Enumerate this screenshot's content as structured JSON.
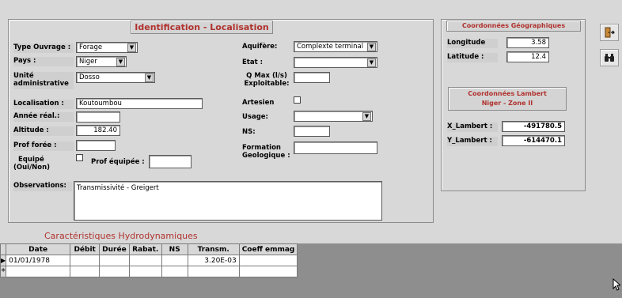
{
  "identification": {
    "title": "Identification - Localisation",
    "type_ouvrage_label": "Type Ouvrage :",
    "type_ouvrage_value": "Forage",
    "pays_label": "Pays :",
    "pays_value": "Niger",
    "unite_label_1": "Unité",
    "unite_label_2": "administrative",
    "unite_value": "Dosso",
    "localisation_label": "Localisation :",
    "localisation_value": "Koutoumbou",
    "annee_label": "Année réal.:",
    "annee_value": "",
    "altitude_label": "Altitude :",
    "altitude_value": "182.40",
    "prof_foree_label": "Prof forée :",
    "prof_foree_value": "",
    "equipe_label_1": "Equipé",
    "equipe_label_2": "(Oui/Non)",
    "prof_equipee_label": "Prof équipée :",
    "prof_equipee_value": "",
    "aquifere_label": "Aquifère:",
    "aquifere_value": "Complexte terminal",
    "etat_label": "Etat :",
    "etat_value": "",
    "qmax_label_1": "Q Max (l/s)",
    "qmax_label_2": "Exploitable:",
    "qmax_value": "",
    "artesien_label": "Artesien",
    "usage_label": "Usage:",
    "usage_value": "",
    "ns_label": "NS:",
    "ns_value": "",
    "formation_label_1": "Formation",
    "formation_label_2": "Geologique :",
    "formation_value": "",
    "observations_label": "Observations:",
    "observations_value": "Transmissivité - Greigert"
  },
  "geo": {
    "title": "Coordonnées Géographiques",
    "longitude_label": "Longitude",
    "longitude_value": "3.58",
    "latitude_label": "Latitude :",
    "latitude_value": "12.4",
    "lambert_title_1": "Coordonnées Lambert",
    "lambert_title_2": "Niger - Zone II",
    "x_label": "X_Lambert :",
    "x_value": "-491780.5",
    "y_label": "Y_Lambert :",
    "y_value": "-614470.1"
  },
  "toolbar": {
    "exit_icon": "door-exit-icon",
    "search_icon": "binoculars-icon"
  },
  "hydro": {
    "title": "Caractéristiques Hydrodynamiques",
    "columns": [
      "Date",
      "Débit",
      "Durée",
      "Rabat.",
      "NS",
      "Transm.",
      "Coeff emmag"
    ],
    "row1": [
      "01/01/1978",
      "",
      "",
      "",
      "",
      "3.20E-03",
      ""
    ],
    "row1_marker": "▶",
    "new_row_marker": "*"
  },
  "colors": {
    "title_red": "#b0322e",
    "background": "#d8d8d8"
  }
}
